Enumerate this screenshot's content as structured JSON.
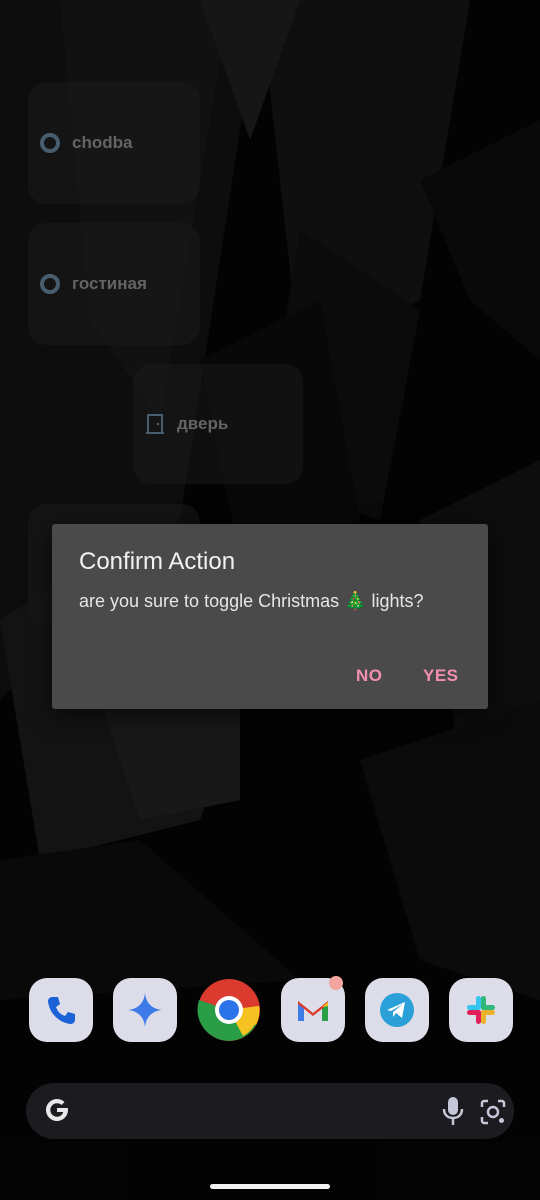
{
  "widgets": [
    {
      "label": "chodba",
      "icon": "ring-icon"
    },
    {
      "label": "гостиная",
      "icon": "ring-icon"
    },
    {
      "label": "дверь",
      "icon": "door-icon"
    }
  ],
  "dialog": {
    "title": "Confirm Action",
    "message": "are you sure to toggle Christmas 🎄 lights?",
    "no_label": "NO",
    "yes_label": "YES",
    "accent": "#f48fb1"
  },
  "dock": [
    {
      "app": "Phone",
      "icon": "phone-icon"
    },
    {
      "app": "Gemini",
      "icon": "gemini-sparkle-icon"
    },
    {
      "app": "Chrome",
      "icon": "chrome-icon"
    },
    {
      "app": "Gmail",
      "icon": "gmail-icon"
    },
    {
      "app": "Telegram",
      "icon": "telegram-icon"
    },
    {
      "app": "Slack",
      "icon": "slack-icon"
    }
  ],
  "search_bar": {
    "icons": [
      "google-g-icon",
      "microphone-icon",
      "lens-icon"
    ]
  }
}
